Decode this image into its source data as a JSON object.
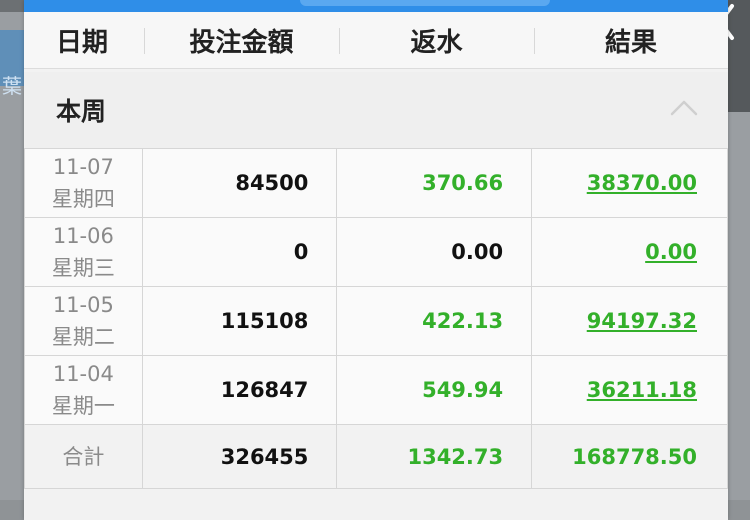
{
  "backdrop": {
    "char": "葉"
  },
  "header": {
    "col_date": "日期",
    "col_bet": "投注金額",
    "col_rebate": "返水",
    "col_result": "結果"
  },
  "section": {
    "title": "本周"
  },
  "rows": [
    {
      "date": "11-07",
      "weekday": "星期四",
      "bet": "84500",
      "rebate": "370.66",
      "result": "38370.00"
    },
    {
      "date": "11-06",
      "weekday": "星期三",
      "bet": "0",
      "rebate": "0.00",
      "result": "0.00"
    },
    {
      "date": "11-05",
      "weekday": "星期二",
      "bet": "115108",
      "rebate": "422.13",
      "result": "94197.32"
    },
    {
      "date": "11-04",
      "weekday": "星期一",
      "bet": "126847",
      "rebate": "549.94",
      "result": "36211.18"
    }
  ],
  "total": {
    "label": "合計",
    "bet": "326455",
    "rebate": "1342.73",
    "result": "168778.50"
  },
  "colors": {
    "green": "#33b02a",
    "accent": "#2f8ee8"
  },
  "icons": {
    "collapse": "chevron-up-icon",
    "back": "back-chevron-icon"
  }
}
